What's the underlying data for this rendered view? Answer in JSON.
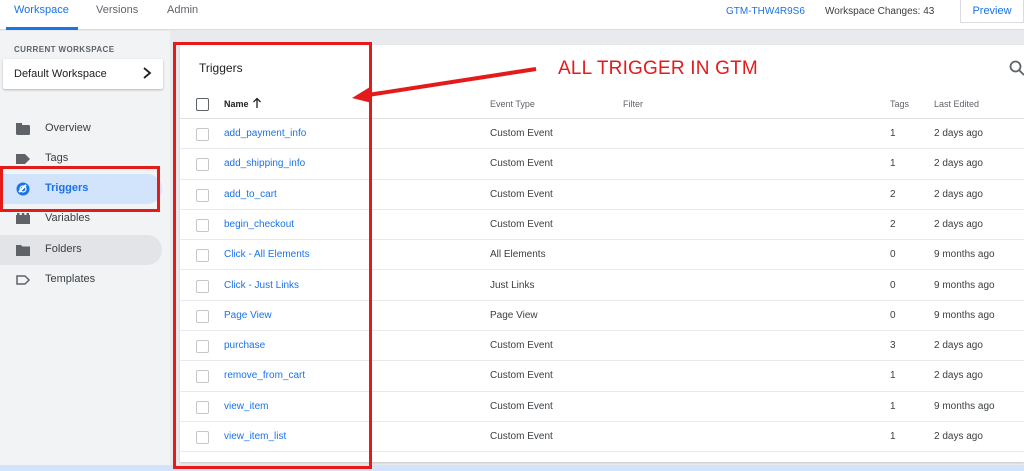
{
  "topbar": {
    "tabs": [
      {
        "label": "Workspace"
      },
      {
        "label": "Versions"
      },
      {
        "label": "Admin"
      }
    ],
    "container_id": "GTM-THW4R9S6",
    "workspace_changes": "Workspace Changes: 43",
    "preview_label": "Preview"
  },
  "sidebar": {
    "workspace_label": "CURRENT WORKSPACE",
    "workspace_name": "Default Workspace",
    "items": [
      {
        "label": "Overview",
        "icon": "overview-icon"
      },
      {
        "label": "Tags",
        "icon": "tag-icon"
      },
      {
        "label": "Triggers",
        "icon": "trigger-icon"
      },
      {
        "label": "Variables",
        "icon": "variables-icon"
      },
      {
        "label": "Folders",
        "icon": "folder-icon"
      },
      {
        "label": "Templates",
        "icon": "template-icon"
      }
    ],
    "active_item": "Triggers"
  },
  "main": {
    "title": "Triggers",
    "columns": {
      "name": "Name",
      "event_type": "Event Type",
      "filter": "Filter",
      "tags": "Tags",
      "last_edited": "Last Edited"
    },
    "rows": [
      {
        "name": "add_payment_info",
        "event_type": "Custom Event",
        "tags": "1",
        "last_edited": "2 days ago"
      },
      {
        "name": "add_shipping_info",
        "event_type": "Custom Event",
        "tags": "1",
        "last_edited": "2 days ago"
      },
      {
        "name": "add_to_cart",
        "event_type": "Custom Event",
        "tags": "2",
        "last_edited": "2 days ago"
      },
      {
        "name": "begin_checkout",
        "event_type": "Custom Event",
        "tags": "2",
        "last_edited": "2 days ago"
      },
      {
        "name": "Click - All Elements",
        "event_type": "All Elements",
        "tags": "0",
        "last_edited": "9 months ago"
      },
      {
        "name": "Click - Just Links",
        "event_type": "Just Links",
        "tags": "0",
        "last_edited": "9 months ago"
      },
      {
        "name": "Page View",
        "event_type": "Page View",
        "tags": "0",
        "last_edited": "9 months ago"
      },
      {
        "name": "purchase",
        "event_type": "Custom Event",
        "tags": "3",
        "last_edited": "2 days ago"
      },
      {
        "name": "remove_from_cart",
        "event_type": "Custom Event",
        "tags": "1",
        "last_edited": "2 days ago"
      },
      {
        "name": "view_item",
        "event_type": "Custom Event",
        "tags": "1",
        "last_edited": "9 months ago"
      },
      {
        "name": "view_item_list",
        "event_type": "Custom Event",
        "tags": "1",
        "last_edited": "2 days ago"
      }
    ]
  },
  "annotation": {
    "text": "ALL TRIGGER IN GTM",
    "color": "#e31b1b"
  },
  "colors": {
    "accent": "#1a73e8",
    "active_nav_bg": "#d2e3fc"
  }
}
